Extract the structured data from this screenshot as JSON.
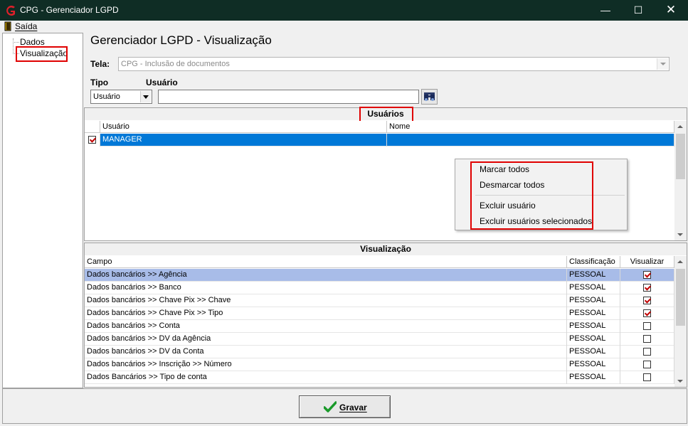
{
  "window": {
    "title": "CPG - Gerenciador LGPD",
    "minimize": "—",
    "maximize": "☐",
    "close": "✕",
    "accent": "#0f2d25"
  },
  "menu": {
    "exit_label": "Saída",
    "exit_icon": "exit-door-icon"
  },
  "tree": {
    "items": [
      {
        "label": "Dados"
      },
      {
        "label": "Visualização",
        "selected": true
      }
    ]
  },
  "header": {
    "title": "Gerenciador LGPD - Visualização",
    "tela_label": "Tela:",
    "tela_value": "CPG - Inclusão de documentos",
    "tipo_label": "Tipo",
    "usuario_label": "Usuário",
    "tipo_value": "Usuário",
    "usuario_value": "",
    "search_icon": "binoculars-icon"
  },
  "users_panel": {
    "title": "Usuários",
    "columns": [
      "Usuário",
      "Nome"
    ],
    "rows": [
      {
        "checked": true,
        "usuario": "MANAGER",
        "nome": "",
        "selected": true
      }
    ]
  },
  "context_menu": {
    "items": [
      "Marcar todos",
      "Desmarcar todos",
      "Excluir usuário",
      "Excluir usuários selecionados"
    ]
  },
  "visual_panel": {
    "title": "Visualização",
    "columns": [
      "Campo",
      "Classificação",
      "Visualizar"
    ],
    "rows": [
      {
        "campo": "Dados bancários >> Agência",
        "classificacao": "PESSOAL",
        "visualizar": true,
        "selected": true
      },
      {
        "campo": "Dados bancários >> Banco",
        "classificacao": "PESSOAL",
        "visualizar": true
      },
      {
        "campo": "Dados bancários >> Chave Pix >> Chave",
        "classificacao": "PESSOAL",
        "visualizar": true
      },
      {
        "campo": "Dados bancários >> Chave Pix >> Tipo",
        "classificacao": "PESSOAL",
        "visualizar": true
      },
      {
        "campo": "Dados bancários >> Conta",
        "classificacao": "PESSOAL",
        "visualizar": false
      },
      {
        "campo": "Dados bancários >> DV da Agência",
        "classificacao": "PESSOAL",
        "visualizar": false
      },
      {
        "campo": "Dados bancários >> DV da Conta",
        "classificacao": "PESSOAL",
        "visualizar": false
      },
      {
        "campo": "Dados bancários >> Inscrição >> Número",
        "classificacao": "PESSOAL",
        "visualizar": false
      },
      {
        "campo": "Dados Bancários >> Tipo de conta",
        "classificacao": "PESSOAL",
        "visualizar": false
      }
    ]
  },
  "footer": {
    "save_label": "Gravar",
    "save_icon": "checkmark-icon"
  },
  "colors": {
    "selection_blue": "#0078d7",
    "row_highlight": "#a8bce8",
    "annotation_red": "#e00000"
  }
}
